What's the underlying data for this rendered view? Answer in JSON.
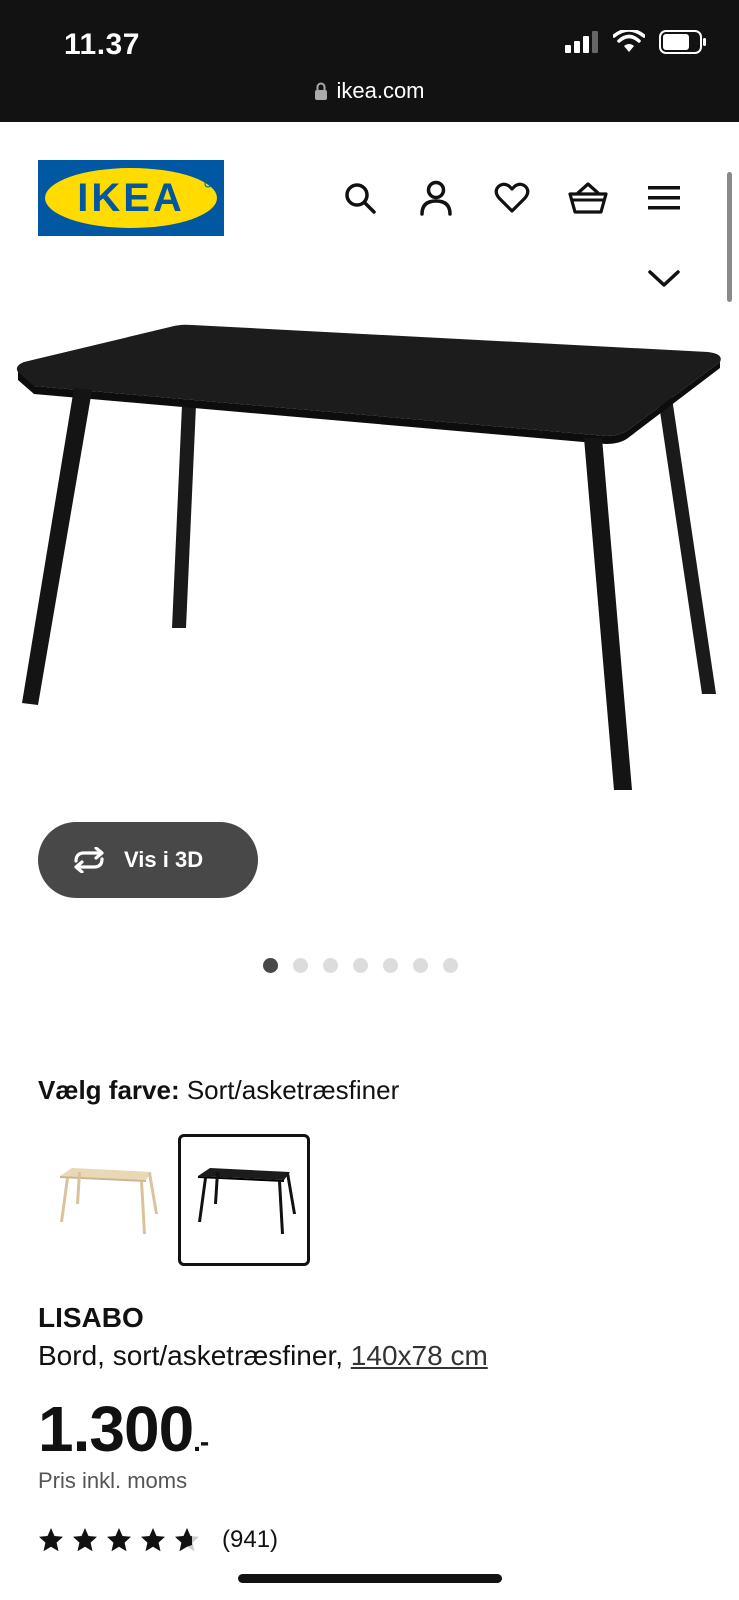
{
  "status_bar": {
    "time": "11.37",
    "url": "ikea.com",
    "icons": [
      "signal-icon",
      "wifi-icon",
      "battery-icon",
      "lock-icon"
    ]
  },
  "header": {
    "logo_text": "IKEA",
    "icons": [
      "search-icon",
      "account-icon",
      "heart-icon",
      "basket-icon",
      "menu-icon",
      "chevron-down-icon"
    ]
  },
  "gallery": {
    "button_3d_label": "Vis i 3D",
    "dot_count": 7,
    "active_index": 0
  },
  "color": {
    "label": "Vælg farve:",
    "selected_value": "Sort/asketræsfiner",
    "options": [
      "asketræsfiner",
      "sort/asketræsfiner"
    ],
    "selected_index": 1
  },
  "product": {
    "name": "LISABO",
    "description_prefix": "Bord, sort/asketræsfiner, ",
    "size": "140x78 cm",
    "price": "1.300",
    "price_suffix": ".-",
    "vat_note": "Pris inkl. moms",
    "rating": 4.5,
    "review_count": "(941)"
  },
  "colors": {
    "status_bg": "#121212",
    "ikea_blue": "#0058a3",
    "ikea_yellow": "#ffdb00",
    "button_bg": "#484848"
  }
}
